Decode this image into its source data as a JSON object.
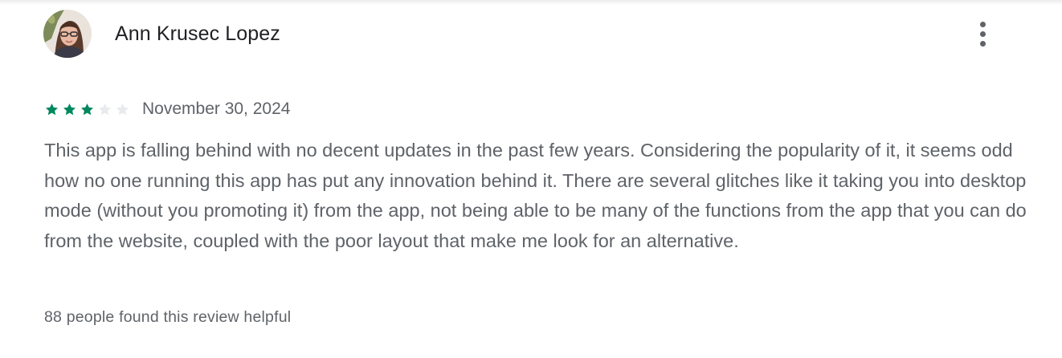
{
  "review": {
    "author": "Ann Krusec Lopez",
    "rating": 3,
    "max_rating": 5,
    "date": "November 30, 2024",
    "text": "This app is falling behind with no decent updates in the past few years. Considering the popularity of it, it seems odd how no one running this app has put any innovation behind it. There are several glitches like it taking you into desktop mode (without you promoting it) from the app, not being able to be many of the functions from the app that you can do from the website, coupled with the poor layout that make me look for an alternative.",
    "helpful": "88 people found this review helpful",
    "more_icon": "more-vert-icon",
    "star_filled_icon": "star-filled-icon",
    "star_empty_icon": "star-empty-icon"
  },
  "colors": {
    "star_filled": "#01875f",
    "star_empty": "#e8eaed",
    "secondary_text": "#5f6368",
    "primary_text": "#202124"
  }
}
